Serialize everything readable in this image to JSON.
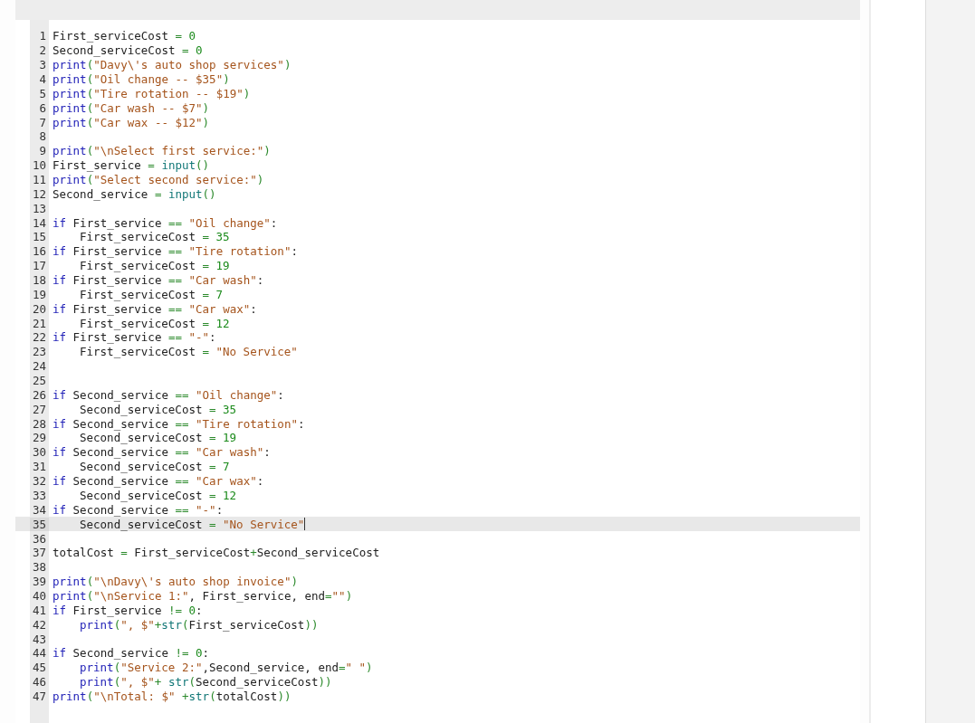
{
  "editor": {
    "lines": [
      {
        "number": "1",
        "active": false,
        "indented": false,
        "tokens": [
          {
            "text": "First_serviceCost",
            "kind": "name"
          },
          {
            "text": " = ",
            "kind": "op"
          },
          {
            "text": "0",
            "kind": "num"
          }
        ]
      },
      {
        "number": "2",
        "active": false,
        "indented": false,
        "tokens": [
          {
            "text": "Second_serviceCost",
            "kind": "name"
          },
          {
            "text": " = ",
            "kind": "op"
          },
          {
            "text": "0",
            "kind": "num"
          }
        ]
      },
      {
        "number": "3",
        "active": false,
        "indented": false,
        "tokens": [
          {
            "text": "print",
            "kind": "kw"
          },
          {
            "text": "(",
            "kind": "op"
          },
          {
            "text": "\"Davy\\'s auto shop services\"",
            "kind": "str"
          },
          {
            "text": ")",
            "kind": "op"
          }
        ]
      },
      {
        "number": "4",
        "active": false,
        "indented": false,
        "tokens": [
          {
            "text": "print",
            "kind": "kw"
          },
          {
            "text": "(",
            "kind": "op"
          },
          {
            "text": "\"Oil change -- $35\"",
            "kind": "str"
          },
          {
            "text": ")",
            "kind": "op"
          }
        ]
      },
      {
        "number": "5",
        "active": false,
        "indented": false,
        "tokens": [
          {
            "text": "print",
            "kind": "kw"
          },
          {
            "text": "(",
            "kind": "op"
          },
          {
            "text": "\"Tire rotation -- $19\"",
            "kind": "str"
          },
          {
            "text": ")",
            "kind": "op"
          }
        ]
      },
      {
        "number": "6",
        "active": false,
        "indented": false,
        "tokens": [
          {
            "text": "print",
            "kind": "kw"
          },
          {
            "text": "(",
            "kind": "op"
          },
          {
            "text": "\"Car wash -- $7\"",
            "kind": "str"
          },
          {
            "text": ")",
            "kind": "op"
          }
        ]
      },
      {
        "number": "7",
        "active": false,
        "indented": false,
        "tokens": [
          {
            "text": "print",
            "kind": "kw"
          },
          {
            "text": "(",
            "kind": "op"
          },
          {
            "text": "\"Car wax -- $12\"",
            "kind": "str"
          },
          {
            "text": ")",
            "kind": "op"
          }
        ]
      },
      {
        "number": "8",
        "active": false
      },
      {
        "number": "9",
        "active": false,
        "indented": false,
        "tokens": [
          {
            "text": "print",
            "kind": "kw"
          },
          {
            "text": "(",
            "kind": "op"
          },
          {
            "text": "\"\\nSelect first service:\"",
            "kind": "str"
          },
          {
            "text": ")",
            "kind": "op"
          }
        ]
      },
      {
        "number": "10",
        "active": false,
        "indented": false,
        "tokens": [
          {
            "text": "First_service",
            "kind": "name"
          },
          {
            "text": " = ",
            "kind": "op"
          },
          {
            "text": "input",
            "kind": "builtin"
          },
          {
            "text": "()",
            "kind": "op"
          }
        ]
      },
      {
        "number": "11",
        "active": false,
        "indented": false,
        "tokens": [
          {
            "text": "print",
            "kind": "kw"
          },
          {
            "text": "(",
            "kind": "op"
          },
          {
            "text": "\"Select second service:\"",
            "kind": "str"
          },
          {
            "text": ")",
            "kind": "op"
          }
        ]
      },
      {
        "number": "12",
        "active": false,
        "indented": false,
        "tokens": [
          {
            "text": "Second_service",
            "kind": "name"
          },
          {
            "text": " = ",
            "kind": "op"
          },
          {
            "text": "input",
            "kind": "builtin"
          },
          {
            "text": "()",
            "kind": "op"
          }
        ]
      },
      {
        "number": "13",
        "active": false
      },
      {
        "number": "14",
        "active": false,
        "indented": false,
        "tokens": [
          {
            "text": "if ",
            "kind": "kw"
          },
          {
            "text": "First_service",
            "kind": "name"
          },
          {
            "text": " == ",
            "kind": "op"
          },
          {
            "text": "\"Oil change\"",
            "kind": "str"
          },
          {
            "text": ":",
            "kind": "name"
          }
        ]
      },
      {
        "number": "15",
        "active": false,
        "indented": true,
        "tokens": [
          {
            "text": "First_serviceCost",
            "kind": "name"
          },
          {
            "text": " = ",
            "kind": "op"
          },
          {
            "text": "35",
            "kind": "num"
          }
        ]
      },
      {
        "number": "16",
        "active": false,
        "indented": false,
        "tokens": [
          {
            "text": "if ",
            "kind": "kw"
          },
          {
            "text": "First_service",
            "kind": "name"
          },
          {
            "text": " == ",
            "kind": "op"
          },
          {
            "text": "\"Tire rotation\"",
            "kind": "str"
          },
          {
            "text": ":",
            "kind": "name"
          }
        ]
      },
      {
        "number": "17",
        "active": false,
        "indented": true,
        "tokens": [
          {
            "text": "First_serviceCost",
            "kind": "name"
          },
          {
            "text": " = ",
            "kind": "op"
          },
          {
            "text": "19",
            "kind": "num"
          }
        ]
      },
      {
        "number": "18",
        "active": false,
        "indented": false,
        "tokens": [
          {
            "text": "if ",
            "kind": "kw"
          },
          {
            "text": "First_service",
            "kind": "name"
          },
          {
            "text": " == ",
            "kind": "op"
          },
          {
            "text": "\"Car wash\"",
            "kind": "str"
          },
          {
            "text": ":",
            "kind": "name"
          }
        ]
      },
      {
        "number": "19",
        "active": false,
        "indented": true,
        "tokens": [
          {
            "text": "First_serviceCost",
            "kind": "name"
          },
          {
            "text": " = ",
            "kind": "op"
          },
          {
            "text": "7",
            "kind": "num"
          }
        ]
      },
      {
        "number": "20",
        "active": false,
        "indented": false,
        "tokens": [
          {
            "text": "if ",
            "kind": "kw"
          },
          {
            "text": "First_service",
            "kind": "name"
          },
          {
            "text": " == ",
            "kind": "op"
          },
          {
            "text": "\"Car wax\"",
            "kind": "str"
          },
          {
            "text": ":",
            "kind": "name"
          }
        ]
      },
      {
        "number": "21",
        "active": false,
        "indented": true,
        "tokens": [
          {
            "text": "First_serviceCost",
            "kind": "name"
          },
          {
            "text": " = ",
            "kind": "op"
          },
          {
            "text": "12",
            "kind": "num"
          }
        ]
      },
      {
        "number": "22",
        "active": false,
        "indented": false,
        "tokens": [
          {
            "text": "if ",
            "kind": "kw"
          },
          {
            "text": "First_service",
            "kind": "name"
          },
          {
            "text": " == ",
            "kind": "op"
          },
          {
            "text": "\"-\"",
            "kind": "str"
          },
          {
            "text": ":",
            "kind": "name"
          }
        ]
      },
      {
        "number": "23",
        "active": false,
        "indented": true,
        "tokens": [
          {
            "text": "First_serviceCost",
            "kind": "name"
          },
          {
            "text": " = ",
            "kind": "op"
          },
          {
            "text": "\"No Service\"",
            "kind": "str"
          }
        ]
      },
      {
        "number": "24",
        "active": false
      },
      {
        "number": "25",
        "active": false
      },
      {
        "number": "26",
        "active": false,
        "indented": false,
        "tokens": [
          {
            "text": "if ",
            "kind": "kw"
          },
          {
            "text": "Second_service",
            "kind": "name"
          },
          {
            "text": " == ",
            "kind": "op"
          },
          {
            "text": "\"Oil change\"",
            "kind": "str"
          },
          {
            "text": ":",
            "kind": "name"
          }
        ]
      },
      {
        "number": "27",
        "active": false,
        "indented": true,
        "tokens": [
          {
            "text": "Second_serviceCost",
            "kind": "name"
          },
          {
            "text": " = ",
            "kind": "op"
          },
          {
            "text": "35",
            "kind": "num"
          }
        ]
      },
      {
        "number": "28",
        "active": false,
        "indented": false,
        "tokens": [
          {
            "text": "if ",
            "kind": "kw"
          },
          {
            "text": "Second_service",
            "kind": "name"
          },
          {
            "text": " == ",
            "kind": "op"
          },
          {
            "text": "\"Tire rotation\"",
            "kind": "str"
          },
          {
            "text": ":",
            "kind": "name"
          }
        ]
      },
      {
        "number": "29",
        "active": false,
        "indented": true,
        "tokens": [
          {
            "text": "Second_serviceCost",
            "kind": "name"
          },
          {
            "text": " = ",
            "kind": "op"
          },
          {
            "text": "19",
            "kind": "num"
          }
        ]
      },
      {
        "number": "30",
        "active": false,
        "indented": false,
        "tokens": [
          {
            "text": "if ",
            "kind": "kw"
          },
          {
            "text": "Second_service",
            "kind": "name"
          },
          {
            "text": " == ",
            "kind": "op"
          },
          {
            "text": "\"Car wash\"",
            "kind": "str"
          },
          {
            "text": ":",
            "kind": "name"
          }
        ]
      },
      {
        "number": "31",
        "active": false,
        "indented": true,
        "tokens": [
          {
            "text": "Second_serviceCost",
            "kind": "name"
          },
          {
            "text": " = ",
            "kind": "op"
          },
          {
            "text": "7",
            "kind": "num"
          }
        ]
      },
      {
        "number": "32",
        "active": false,
        "indented": false,
        "tokens": [
          {
            "text": "if ",
            "kind": "kw"
          },
          {
            "text": "Second_service",
            "kind": "name"
          },
          {
            "text": " == ",
            "kind": "op"
          },
          {
            "text": "\"Car wax\"",
            "kind": "str"
          },
          {
            "text": ":",
            "kind": "name"
          }
        ]
      },
      {
        "number": "33",
        "active": false,
        "indented": true,
        "tokens": [
          {
            "text": "Second_serviceCost",
            "kind": "name"
          },
          {
            "text": " = ",
            "kind": "op"
          },
          {
            "text": "12",
            "kind": "num"
          }
        ]
      },
      {
        "number": "34",
        "active": false,
        "indented": false,
        "tokens": [
          {
            "text": "if ",
            "kind": "kw"
          },
          {
            "text": "Second_service",
            "kind": "name"
          },
          {
            "text": " == ",
            "kind": "op"
          },
          {
            "text": "\"-\"",
            "kind": "str"
          },
          {
            "text": ":",
            "kind": "name"
          }
        ]
      },
      {
        "number": "35",
        "active": true,
        "indented": true,
        "tokens": [
          {
            "text": "Second_serviceCost",
            "kind": "name"
          },
          {
            "text": " = ",
            "kind": "op"
          },
          {
            "text": "\"No Service\"",
            "kind": "str"
          }
        ]
      },
      {
        "number": "36",
        "active": false
      },
      {
        "number": "37",
        "active": false,
        "indented": false,
        "tokens": [
          {
            "text": "totalCost",
            "kind": "name"
          },
          {
            "text": " = ",
            "kind": "op"
          },
          {
            "text": "First_serviceCost",
            "kind": "name"
          },
          {
            "text": "+",
            "kind": "op"
          },
          {
            "text": "Second_serviceCost",
            "kind": "name"
          }
        ]
      },
      {
        "number": "38",
        "active": false
      },
      {
        "number": "39",
        "active": false,
        "indented": false,
        "tokens": [
          {
            "text": "print",
            "kind": "kw"
          },
          {
            "text": "(",
            "kind": "op"
          },
          {
            "text": "\"\\nDavy\\'s auto shop invoice\"",
            "kind": "str"
          },
          {
            "text": ")",
            "kind": "op"
          }
        ]
      },
      {
        "number": "40",
        "active": false,
        "indented": false,
        "tokens": [
          {
            "text": "print",
            "kind": "kw"
          },
          {
            "text": "(",
            "kind": "op"
          },
          {
            "text": "\"\\nService 1:\"",
            "kind": "str"
          },
          {
            "text": ", First_service, end",
            "kind": "name"
          },
          {
            "text": "=",
            "kind": "op"
          },
          {
            "text": "\"\"",
            "kind": "str"
          },
          {
            "text": ")",
            "kind": "op"
          }
        ]
      },
      {
        "number": "41",
        "active": false,
        "indented": false,
        "tokens": [
          {
            "text": "if ",
            "kind": "kw"
          },
          {
            "text": "First_service",
            "kind": "name"
          },
          {
            "text": " != ",
            "kind": "op"
          },
          {
            "text": "0",
            "kind": "num"
          },
          {
            "text": ":",
            "kind": "name"
          }
        ]
      },
      {
        "number": "42",
        "active": false,
        "indented": true,
        "tokens": [
          {
            "text": "print",
            "kind": "kw"
          },
          {
            "text": "(",
            "kind": "op"
          },
          {
            "text": "\", $\"",
            "kind": "str"
          },
          {
            "text": "+",
            "kind": "op"
          },
          {
            "text": "str",
            "kind": "builtin"
          },
          {
            "text": "(",
            "kind": "op"
          },
          {
            "text": "First_serviceCost",
            "kind": "name"
          },
          {
            "text": "))",
            "kind": "op"
          }
        ]
      },
      {
        "number": "43",
        "active": false
      },
      {
        "number": "44",
        "active": false,
        "indented": false,
        "tokens": [
          {
            "text": "if ",
            "kind": "kw"
          },
          {
            "text": "Second_service",
            "kind": "name"
          },
          {
            "text": " != ",
            "kind": "op"
          },
          {
            "text": "0",
            "kind": "num"
          },
          {
            "text": ":",
            "kind": "name"
          }
        ]
      },
      {
        "number": "45",
        "active": false,
        "indented": true,
        "tokens": [
          {
            "text": "print",
            "kind": "kw"
          },
          {
            "text": "(",
            "kind": "op"
          },
          {
            "text": "\"Service 2:\"",
            "kind": "str"
          },
          {
            "text": ",Second_service, end",
            "kind": "name"
          },
          {
            "text": "=",
            "kind": "op"
          },
          {
            "text": "\" \"",
            "kind": "str"
          },
          {
            "text": ")",
            "kind": "op"
          }
        ]
      },
      {
        "number": "46",
        "active": false,
        "indented": true,
        "tokens": [
          {
            "text": "print",
            "kind": "kw"
          },
          {
            "text": "(",
            "kind": "op"
          },
          {
            "text": "\", $\"",
            "kind": "str"
          },
          {
            "text": "+ ",
            "kind": "op"
          },
          {
            "text": "str",
            "kind": "builtin"
          },
          {
            "text": "(",
            "kind": "op"
          },
          {
            "text": "Second_serviceCost",
            "kind": "name"
          },
          {
            "text": "))",
            "kind": "op"
          }
        ]
      },
      {
        "number": "47",
        "active": false,
        "indented": false,
        "tokens": [
          {
            "text": "print",
            "kind": "kw"
          },
          {
            "text": "(",
            "kind": "op"
          },
          {
            "text": "\"\\nTotal: $\"",
            "kind": "str"
          },
          {
            "text": " +",
            "kind": "op"
          },
          {
            "text": "str",
            "kind": "builtin"
          },
          {
            "text": "(",
            "kind": "op"
          },
          {
            "text": "totalCost",
            "kind": "name"
          },
          {
            "text": "))",
            "kind": "op"
          }
        ]
      }
    ]
  }
}
